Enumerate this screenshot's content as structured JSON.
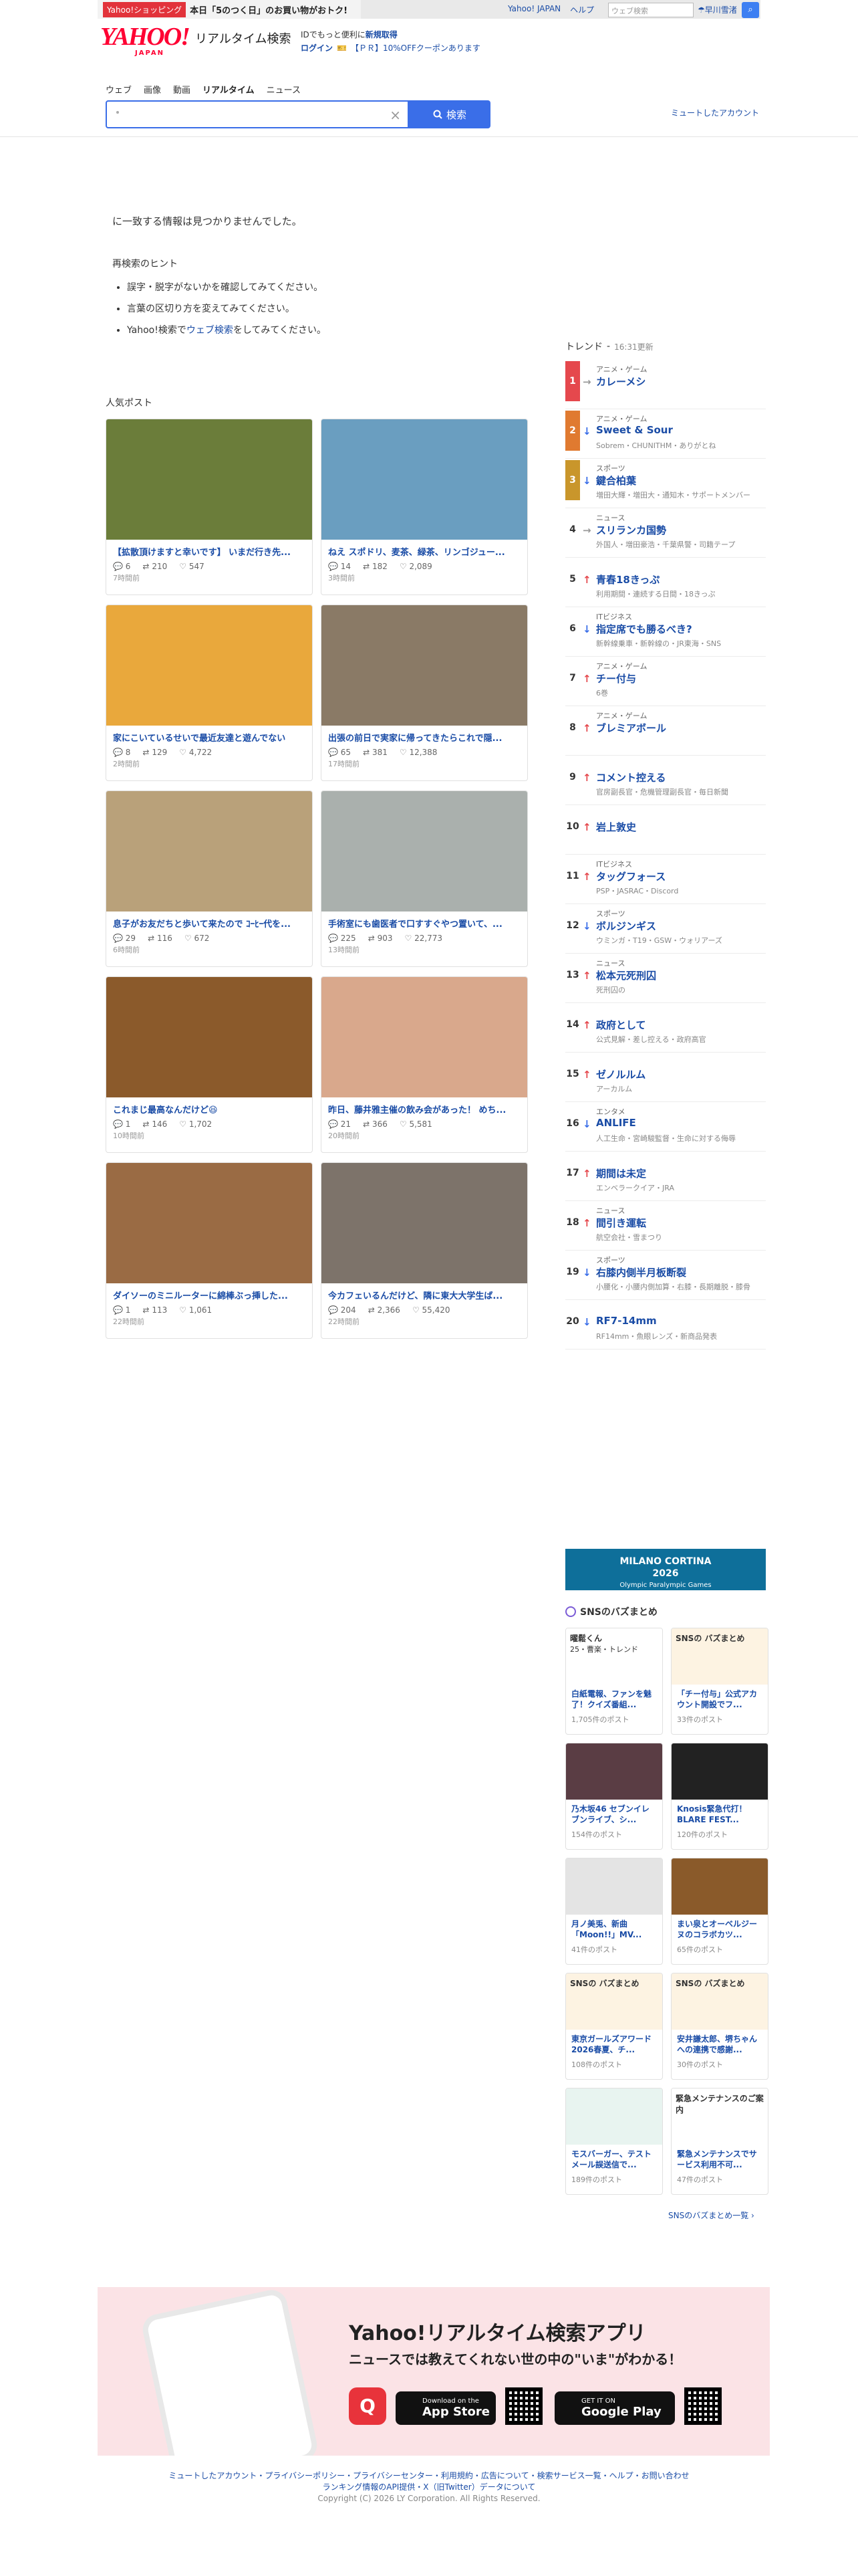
{
  "promo": {
    "tag": "Yahoo!ショッピング",
    "text": "本日「5のつく日」のお買い物がおトク!"
  },
  "header": {
    "logo_main": "YAHOO!",
    "logo_sub": "JAPAN",
    "product": "リアルタイム検索",
    "id_line1": "IDでもっと便利に",
    "id_line1_link": "新規取得",
    "login": "ログイン",
    "coupon": "【ＰＲ】10%OFFクーポンあります",
    "links": [
      "Yahoo! JAPAN",
      "ヘルプ"
    ],
    "top_search_placeholder": "ウェブ検索",
    "weather": "早川雪渚"
  },
  "nav": {
    "tabs": [
      "ウェブ",
      "画像",
      "動画",
      "リアルタイム",
      "ニュース"
    ]
  },
  "search": {
    "query": "",
    "button": "検索",
    "muted": "ミュートしたアカウント"
  },
  "results": {
    "no_result": "に一致する情報は見つかりませんでした。",
    "hint_title": "再検索のヒント",
    "hints": [
      "誤字・脱字がないかを確認してみてください。",
      "言葉の区切り方を変えてみてください。"
    ],
    "hint3_pre": "Yahoo!検索で",
    "hint3_link": "ウェブ検索",
    "hint3_post": "をしてみてください。"
  },
  "popular": {
    "title": "人気ポスト",
    "posts": [
      {
        "text": "【拡散頂けますと幸いです】 いまだ行き先...",
        "replies": "6",
        "reposts": "210",
        "likes": "547",
        "time": "7時間前",
        "img": "#6b7d3a"
      },
      {
        "text": "ねえ スポドリ、麦茶、緑茶、リンゴジュー...",
        "replies": "14",
        "reposts": "182",
        "likes": "2,089",
        "time": "3時間前",
        "img": "#6a9ec0"
      },
      {
        "text": "家にこいているせいで最近友達と遊んでない",
        "replies": "8",
        "reposts": "129",
        "likes": "4,722",
        "time": "2時間前",
        "img": "#e9a83c"
      },
      {
        "text": "出張の前日で実家に帰ってきたらこれで隠...",
        "replies": "65",
        "reposts": "381",
        "likes": "12,388",
        "time": "17時間前",
        "img": "#8a7a66"
      },
      {
        "text": "息子がお友だちと歩いて来たので ｺｰﾋｰ代を...",
        "replies": "29",
        "reposts": "116",
        "likes": "672",
        "time": "6時間前",
        "img": "#b9a17a"
      },
      {
        "text": "手術室にも歯医者で口すすぐやつ置いて、...",
        "replies": "225",
        "reposts": "903",
        "likes": "22,773",
        "time": "13時間前",
        "img": "#aab0ad"
      },
      {
        "text": "これまじ最高なんだけど😆",
        "replies": "1",
        "reposts": "146",
        "likes": "1,702",
        "time": "10時間前",
        "img": "#8b5a2b"
      },
      {
        "text": "昨日、藤井雅主催の飲み会があった！ めち...",
        "replies": "21",
        "reposts": "366",
        "likes": "5,581",
        "time": "20時間前",
        "img": "#d9a88c"
      },
      {
        "text": "ダイソーのミニルーターに綿棒ぶっ挿した...",
        "replies": "1",
        "reposts": "113",
        "likes": "1,061",
        "time": "22時間前",
        "img": "#9a6b44"
      },
      {
        "text": "今カフェいるんだけど、隣に東大大学生ば...",
        "replies": "204",
        "reposts": "2,366",
        "likes": "55,420",
        "time": "22時間前",
        "img": "#7d736a"
      }
    ]
  },
  "trends": {
    "title": "トレンド",
    "updated": "16:31更新",
    "items": [
      {
        "rank": "1",
        "dir": "→",
        "cat": "アニメ・ゲーム",
        "word": "カレーメシ",
        "sub": "",
        "rank_color": "#e5484d"
      },
      {
        "rank": "2",
        "dir": "↓",
        "cat": "アニメ・ゲーム",
        "word": "Sweet & Sour",
        "sub": "Sobrem・CHUNITHM・ありがとね",
        "rank_color": "#e07a30"
      },
      {
        "rank": "3",
        "dir": "↓",
        "cat": "スポーツ",
        "word": "鍵合柏葉",
        "sub": "増田大輝・増田大・通知木・サポートメンバー",
        "rank_color": "#c9962b"
      },
      {
        "rank": "4",
        "dir": "→",
        "cat": "ニュース",
        "word": "スリランカ国勢",
        "sub": "外国人・増田豪浩・千葉県警・司籍テープ",
        "rank_color": ""
      },
      {
        "rank": "5",
        "dir": "↑",
        "cat": "",
        "word": "青春18きっぷ",
        "sub": "利用期間・連続する日間・18きっぷ",
        "rank_color": ""
      },
      {
        "rank": "6",
        "dir": "↓",
        "cat": "ITビジネス",
        "word": "指定席でも勝るべき?",
        "sub": "新幹線乗車・新幹線の・JR東海・SNS",
        "rank_color": ""
      },
      {
        "rank": "7",
        "dir": "↑",
        "cat": "アニメ・ゲーム",
        "word": "チー付与",
        "sub": "6巻",
        "rank_color": ""
      },
      {
        "rank": "8",
        "dir": "↑",
        "cat": "アニメ・ゲーム",
        "word": "ブレミアボール",
        "sub": "",
        "rank_color": ""
      },
      {
        "rank": "9",
        "dir": "↑",
        "cat": "",
        "word": "コメント控える",
        "sub": "官房副長官・危機管理副長官・毎日新聞",
        "rank_color": ""
      },
      {
        "rank": "10",
        "dir": "↑",
        "cat": "",
        "word": "岩上敦史",
        "sub": "",
        "rank_color": ""
      },
      {
        "rank": "11",
        "dir": "↑",
        "cat": "ITビジネス",
        "word": "タッグフォース",
        "sub": "PSP・JASRAC・Discord",
        "rank_color": ""
      },
      {
        "rank": "12",
        "dir": "↓",
        "cat": "スポーツ",
        "word": "ボルジンギス",
        "sub": "ウミンガ・T19・GSW・ウォリアーズ",
        "rank_color": ""
      },
      {
        "rank": "13",
        "dir": "↑",
        "cat": "ニュース",
        "word": "松本元死刑囚",
        "sub": "死刑囚の",
        "rank_color": ""
      },
      {
        "rank": "14",
        "dir": "↑",
        "cat": "",
        "word": "政府として",
        "sub": "公式見解・差し控える・政府高官",
        "rank_color": ""
      },
      {
        "rank": "15",
        "dir": "↑",
        "cat": "",
        "word": "ゼノルルム",
        "sub": "アーカルム",
        "rank_color": ""
      },
      {
        "rank": "16",
        "dir": "↓",
        "cat": "エンタメ",
        "word": "ANLIFE",
        "sub": "人工生命・宮崎駿監督・生命に対する侮辱",
        "rank_color": ""
      },
      {
        "rank": "17",
        "dir": "↑",
        "cat": "",
        "word": "期間は未定",
        "sub": "エンベラークイア・JRA",
        "rank_color": ""
      },
      {
        "rank": "18",
        "dir": "↑",
        "cat": "ニュース",
        "word": "間引き運転",
        "sub": "航空会社・雪まつり",
        "rank_color": ""
      },
      {
        "rank": "19",
        "dir": "↓",
        "cat": "スポーツ",
        "word": "右膝内側半月板断裂",
        "sub": "小腰化・小腰内側加算・右膝・長期離脱・膝骨",
        "rank_color": ""
      },
      {
        "rank": "20",
        "dir": "↓",
        "cat": "",
        "word": "RF7-14mm",
        "sub": "RF14mm・魚眼レンズ・新商品発表",
        "rank_color": ""
      }
    ]
  },
  "banner": {
    "title": "MILANO CORTINA",
    "year": "2026",
    "sub": "Olympic Paralympic Games"
  },
  "sns": {
    "title": "SNSのバズまとめ",
    "more": "SNSのバズまとめ一覧 ›",
    "items": [
      {
        "head": "曜鬆くん",
        "head2": "25・曹楽・トレンド",
        "title": "白紙電報、ファンを魅了！クイズ番組...",
        "count": "1,705件のポスト",
        "img": "#ffffff"
      },
      {
        "head": "SNSの バズまとめ",
        "head2": "",
        "title": "「チー付与」公式アカウント開設でフ...",
        "count": "33件のポスト",
        "img": "#fdf3e2"
      },
      {
        "head": "",
        "head2": "",
        "title": "乃木坂46 セブンイレブンライブ、シ...",
        "count": "154件のポスト",
        "img": "#5a3d44"
      },
      {
        "head": "",
        "head2": "",
        "title": "Knosis緊急代打！BLARE FEST...",
        "count": "120件のポスト",
        "img": "#222222"
      },
      {
        "head": "",
        "head2": "",
        "title": "月ノ美兎、新曲「Moon!!」MV...",
        "count": "41件のポスト",
        "img": "#e4e4e4"
      },
      {
        "head": "",
        "head2": "",
        "title": "まい泉とオーベルジーヌのコラボカツ...",
        "count": "65件のポスト",
        "img": "#8a5a2a"
      },
      {
        "head": "SNSの バズまとめ",
        "head2": "",
        "title": "東京ガールズアワード2026春夏、チ...",
        "count": "108件のポスト",
        "img": "#fdf3e2"
      },
      {
        "head": "SNSの バズまとめ",
        "head2": "",
        "title": "安井謙太郎、堺ちゃんへの連携で感謝...",
        "count": "30件のポスト",
        "img": "#fdf3e2"
      },
      {
        "head": "",
        "head2": "",
        "title": "モスバーガー、テストメール誤送信で...",
        "count": "189件のポスト",
        "img": "#e8f4f0"
      },
      {
        "head": "緊急メンテナンスのご案内",
        "head2": "",
        "title": "緊急メンテナンスでサービス利用不可...",
        "count": "47件のポスト",
        "img": "#ffffff"
      }
    ]
  },
  "app": {
    "title": "Yahoo!リアルタイム検索アプリ",
    "sub": "ニュースでは教えてくれない世の中の\"いま\"がわかる！",
    "appstore_small": "Download on the",
    "appstore": "App Store",
    "googleplay_small": "GET IT ON",
    "googleplay": "Google Play"
  },
  "footer": {
    "links1": "ミュートしたアカウント・プライバシーポリシー・プライバシーセンター・利用規約・広告について・検索サービス一覧・ヘルプ・お問い合わせ",
    "links2": "ランキング情報のAPI提供・X（旧Twitter）データについて",
    "copy": "Copyright (C) 2026 LY Corporation. All Rights Reserved."
  }
}
